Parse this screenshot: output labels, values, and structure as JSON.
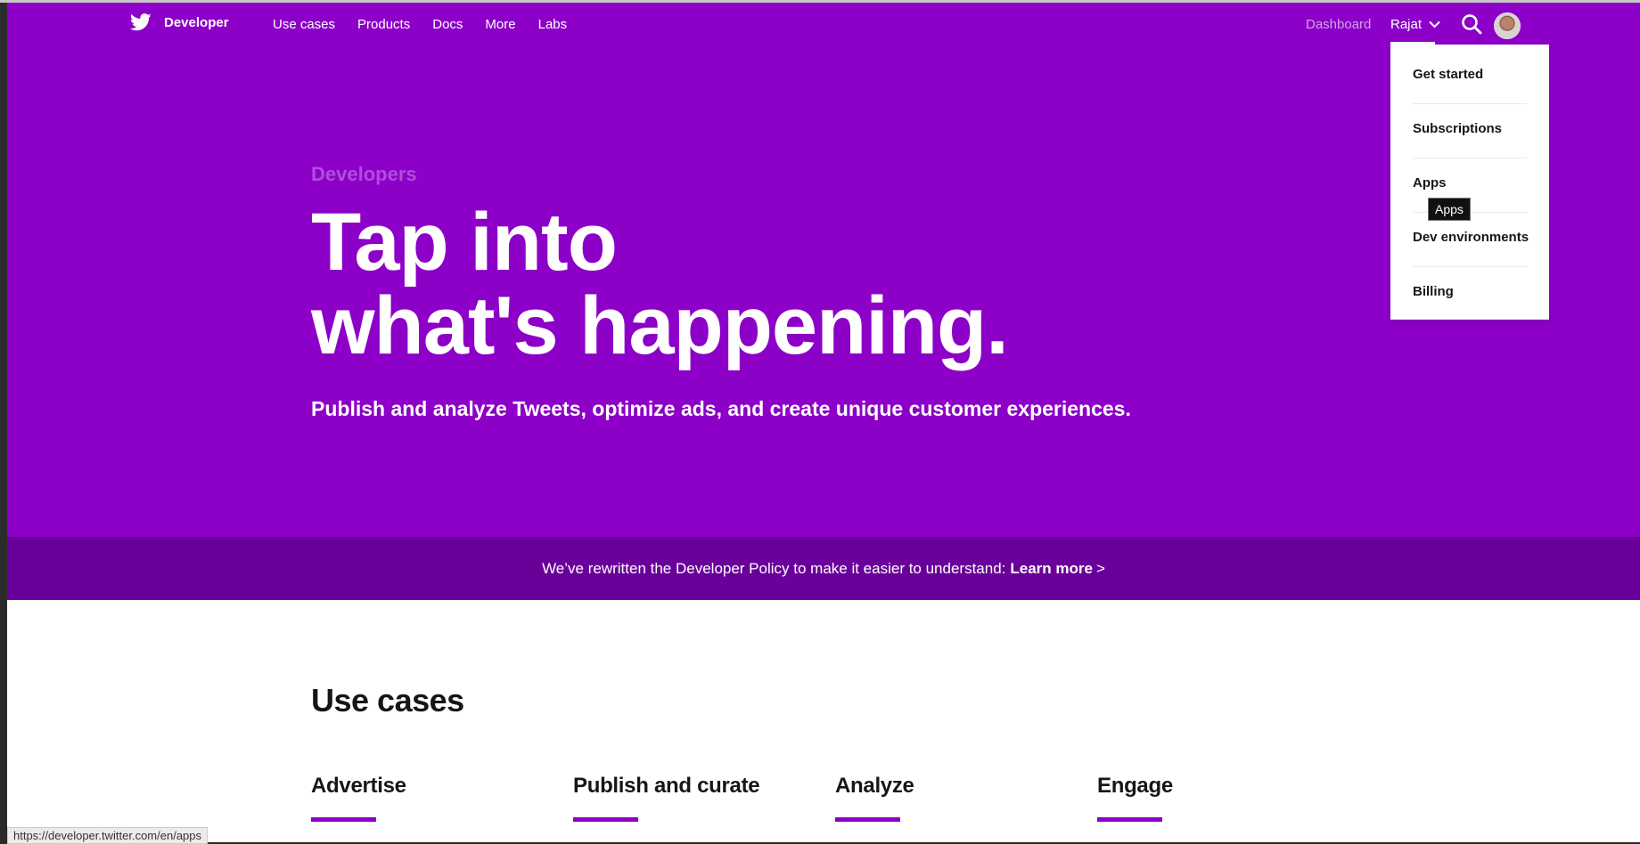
{
  "nav": {
    "brand_name": "Developer",
    "links": [
      "Use cases",
      "Products",
      "Docs",
      "More",
      "Labs"
    ],
    "dashboard": "Dashboard",
    "user": "Rajat"
  },
  "hero": {
    "kicker": "Developers",
    "title_line1": "Tap into",
    "title_line2": "what's happening.",
    "subtitle": "Publish and analyze Tweets, optimize ads, and create unique customer experiences."
  },
  "policy": {
    "text": "We’ve rewritten the Developer Policy to make it easier to understand:",
    "link": "Learn more",
    "chevron": ">"
  },
  "dropdown": {
    "items": [
      "Get started",
      "Subscriptions",
      "Apps",
      "Dev environments",
      "Billing"
    ],
    "tooltip": "Apps"
  },
  "use_cases": {
    "title": "Use cases",
    "items": [
      "Advertise",
      "Publish and curate",
      "Analyze",
      "Engage"
    ]
  },
  "status_bar": {
    "url": "https://developer.twitter.com/en/apps"
  },
  "colors": {
    "brand_purple": "#8c00c8",
    "banner_purple": "#6a009a",
    "kicker_purple": "#b14ddf"
  }
}
